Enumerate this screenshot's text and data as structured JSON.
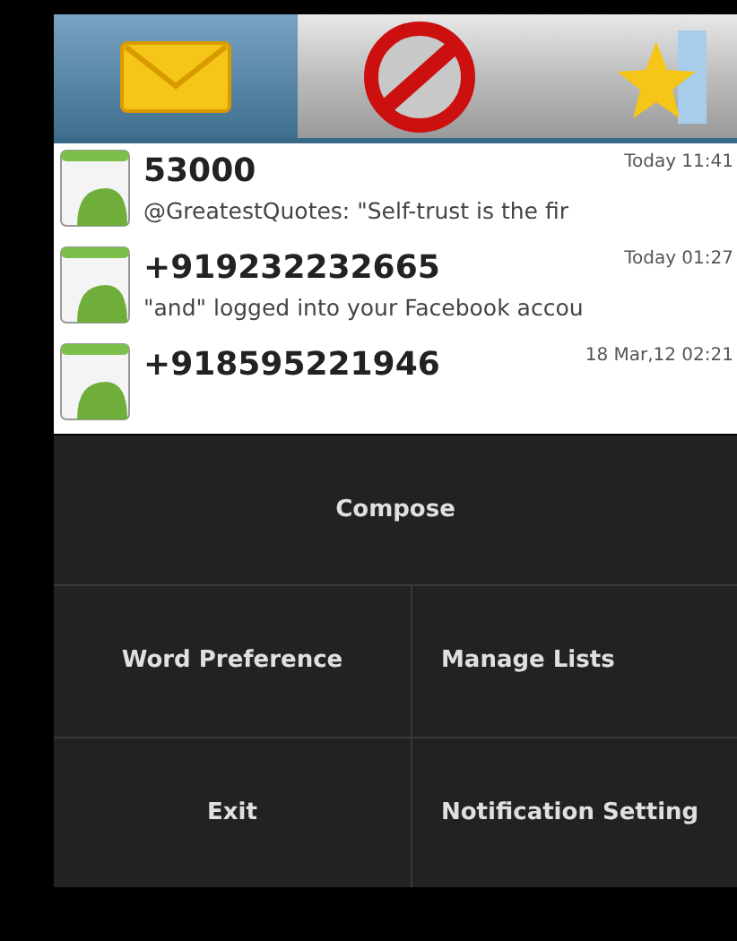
{
  "tabs": [
    {
      "selected": true
    },
    {
      "selected": false
    },
    {
      "selected": false
    }
  ],
  "messages": [
    {
      "sender": "53000",
      "time": "Today 11:41",
      "preview": "@GreatestQuotes: \"Self-trust is the fir"
    },
    {
      "sender": "+919232232665",
      "time": "Today 01:27",
      "preview": "\"and\" logged into your Facebook accou"
    },
    {
      "sender": "+918595221946",
      "time": "18 Mar,12 02:21"
    }
  ],
  "menu": [
    [
      "Compose"
    ],
    [
      "Word Preference",
      "Manage Lists"
    ],
    [
      "Exit",
      "Notification Setting"
    ]
  ]
}
